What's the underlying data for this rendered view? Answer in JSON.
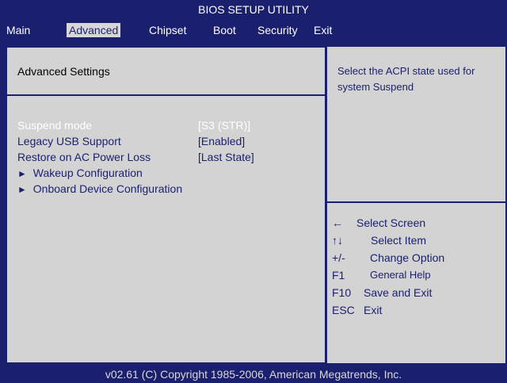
{
  "title": "BIOS SETUP UTILITY",
  "menu": [
    {
      "label": "Main"
    },
    {
      "label": "Advanced"
    },
    {
      "label": "Chipset"
    },
    {
      "label": "Boot"
    },
    {
      "label": "Security"
    },
    {
      "label": "Exit"
    }
  ],
  "active_menu": "Advanced",
  "section_title": "Advanced Settings",
  "settings": [
    {
      "label": "Suspend mode",
      "value": "[S3 (STR)]",
      "selected": true
    },
    {
      "label": "Legacy USB Support",
      "value": "[Enabled]"
    },
    {
      "label": "Restore on AC Power Loss",
      "value": "[Last State]"
    }
  ],
  "submenus": [
    {
      "arrow": "►",
      "label": "Wakeup Configuration"
    },
    {
      "arrow": "►",
      "label": "Onboard Device Configuration"
    }
  ],
  "help_text": "Select the ACPI state used for system Suspend",
  "keys": [
    {
      "key": "←",
      "desc": "Select Screen"
    },
    {
      "key": "↑↓",
      "desc": "Select Item"
    },
    {
      "key": "+/-",
      "desc": "Change Option"
    },
    {
      "key": "F1",
      "desc": "General Help"
    },
    {
      "key": "F10",
      "desc": "Save and Exit"
    },
    {
      "key": "ESC",
      "desc": "Exit"
    }
  ],
  "footer": "v02.61 (C) Copyright 1985-2006, American Megatrends, Inc.",
  "colors": {
    "background_blue": "#1a1f6e",
    "panel_gray": "#d3d3d3",
    "selected_text": "#ffffff"
  }
}
